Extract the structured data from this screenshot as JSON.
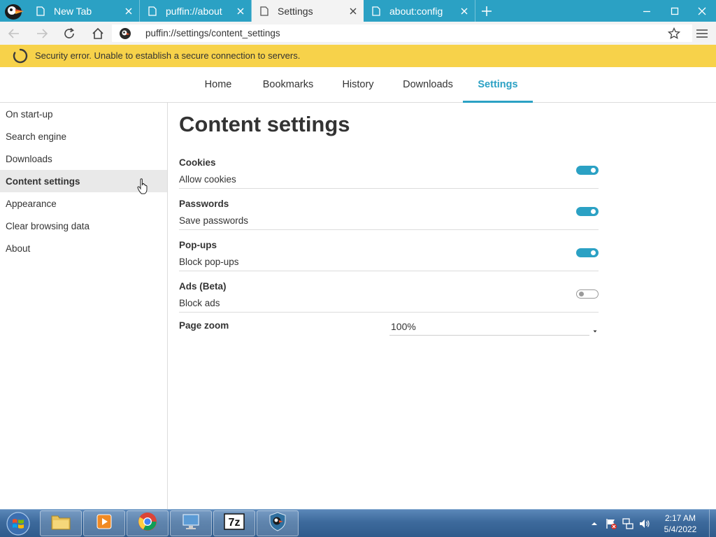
{
  "tabs": [
    {
      "title": "New Tab"
    },
    {
      "title": "puffin://about"
    },
    {
      "title": "Settings"
    },
    {
      "title": "about:config"
    }
  ],
  "toolbar": {
    "url": "puffin://settings/content_settings"
  },
  "warning": {
    "message": "Security error. Unable to establish a secure connection to servers."
  },
  "nav": {
    "items": [
      "Home",
      "Bookmarks",
      "History",
      "Downloads",
      "Settings"
    ],
    "active": "Settings"
  },
  "sidebar": {
    "items": [
      "On start-up",
      "Search engine",
      "Downloads",
      "Content settings",
      "Appearance",
      "Clear browsing data",
      "About"
    ],
    "active": "Content settings"
  },
  "content": {
    "title": "Content settings",
    "settings": [
      {
        "name": "Cookies",
        "desc": "Allow cookies",
        "enabled": true
      },
      {
        "name": "Passwords",
        "desc": "Save passwords",
        "enabled": true
      },
      {
        "name": "Pop-ups",
        "desc": "Block pop-ups",
        "enabled": true
      },
      {
        "name": "Ads (Beta)",
        "desc": "Block ads",
        "enabled": false
      }
    ],
    "zoom": {
      "label": "Page zoom",
      "value": "100%"
    }
  },
  "taskbar": {
    "apps": [
      "file-explorer",
      "media-player",
      "chrome",
      "remote-desktop",
      "7zip",
      "puffin-browser"
    ],
    "clock": {
      "time": "2:17 AM",
      "date": "5/4/2022"
    }
  },
  "colors": {
    "accent": "#2ba1c4",
    "warning": "#f7d24a",
    "toggle_off": "#9a9a9a"
  }
}
